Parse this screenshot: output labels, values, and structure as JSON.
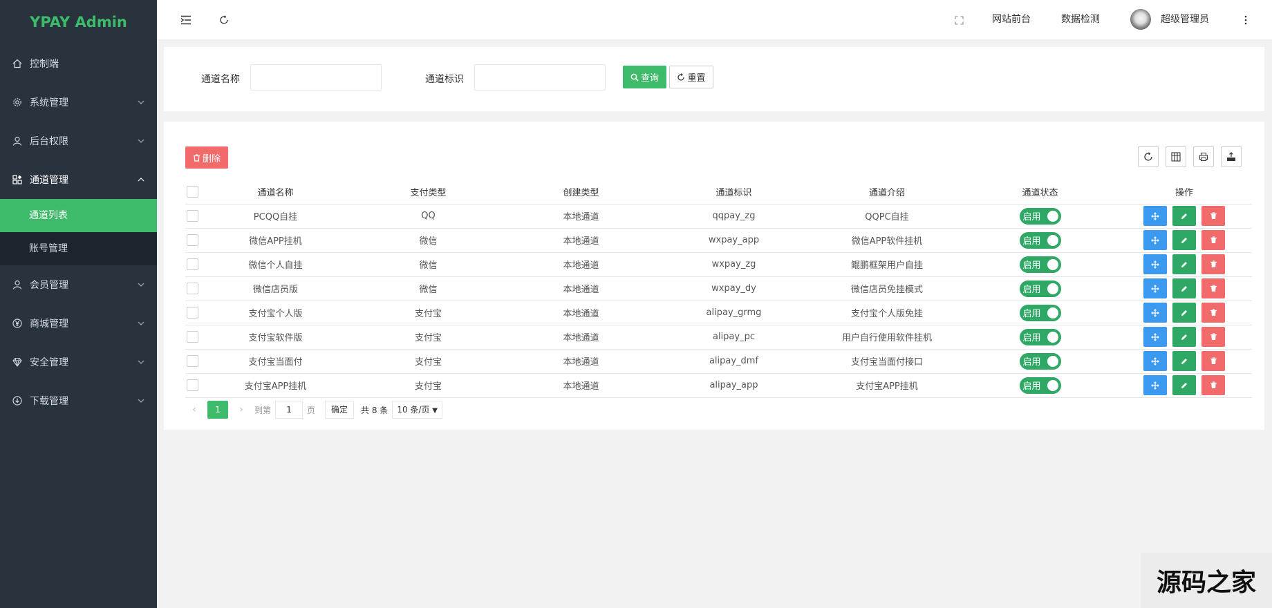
{
  "sidebar": {
    "logo": "YPAY Admin",
    "items": [
      {
        "label": "控制端"
      },
      {
        "label": "系统管理"
      },
      {
        "label": "后台权限"
      },
      {
        "label": "通道管理"
      },
      {
        "label": "会员管理"
      },
      {
        "label": "商城管理"
      },
      {
        "label": "安全管理"
      },
      {
        "label": "下载管理"
      }
    ],
    "submenu": [
      {
        "label": "通道列表",
        "active": true
      },
      {
        "label": "账号管理",
        "active": false
      }
    ]
  },
  "header": {
    "site_front": "网站前台",
    "data_check": "数据检测",
    "user_name": "超级管理员"
  },
  "search": {
    "name_label": "通道名称",
    "id_label": "通道标识",
    "name_value": "",
    "id_value": "",
    "search_btn": "查询",
    "reset_btn": "重置"
  },
  "toolbar": {
    "delete_btn": "删除"
  },
  "table": {
    "headers": [
      "通道名称",
      "支付类型",
      "创建类型",
      "通道标识",
      "通道介绍",
      "通道状态",
      "操作"
    ],
    "rows": [
      {
        "name": "PCQQ自挂",
        "pay_type": "QQ",
        "create_type": "本地通道",
        "ident": "qqpay_zg",
        "intro": "QQPC自挂",
        "status": "启用"
      },
      {
        "name": "微信APP挂机",
        "pay_type": "微信",
        "create_type": "本地通道",
        "ident": "wxpay_app",
        "intro": "微信APP软件挂机",
        "status": "启用"
      },
      {
        "name": "微信个人自挂",
        "pay_type": "微信",
        "create_type": "本地通道",
        "ident": "wxpay_zg",
        "intro": "鲲鹏框架用户自挂",
        "status": "启用"
      },
      {
        "name": "微信店员版",
        "pay_type": "微信",
        "create_type": "本地通道",
        "ident": "wxpay_dy",
        "intro": "微信店员免挂模式",
        "status": "启用"
      },
      {
        "name": "支付宝个人版",
        "pay_type": "支付宝",
        "create_type": "本地通道",
        "ident": "alipay_grmg",
        "intro": "支付宝个人版免挂",
        "status": "启用"
      },
      {
        "name": "支付宝软件版",
        "pay_type": "支付宝",
        "create_type": "本地通道",
        "ident": "alipay_pc",
        "intro": "用户自行使用软件挂机",
        "status": "启用"
      },
      {
        "name": "支付宝当面付",
        "pay_type": "支付宝",
        "create_type": "本地通道",
        "ident": "alipay_dmf",
        "intro": "支付宝当面付接口",
        "status": "启用"
      },
      {
        "name": "支付宝APP挂机",
        "pay_type": "支付宝",
        "create_type": "本地通道",
        "ident": "alipay_app",
        "intro": "支付宝APP挂机",
        "status": "启用"
      }
    ]
  },
  "pager": {
    "current_page": "1",
    "goto_label": "到第",
    "goto_value": "1",
    "page_unit": "页",
    "confirm_btn": "确定",
    "total": "共 8 条",
    "page_size": "10 条/页"
  },
  "watermark": "源码之家",
  "colors": {
    "sidebar_bg": "#28333e",
    "accent_green": "#3dbb6a",
    "delete_red": "#f16b6b",
    "move_blue": "#3b9af0",
    "qq_orange": "#e8572a",
    "alipay_blue": "#3395e6"
  }
}
